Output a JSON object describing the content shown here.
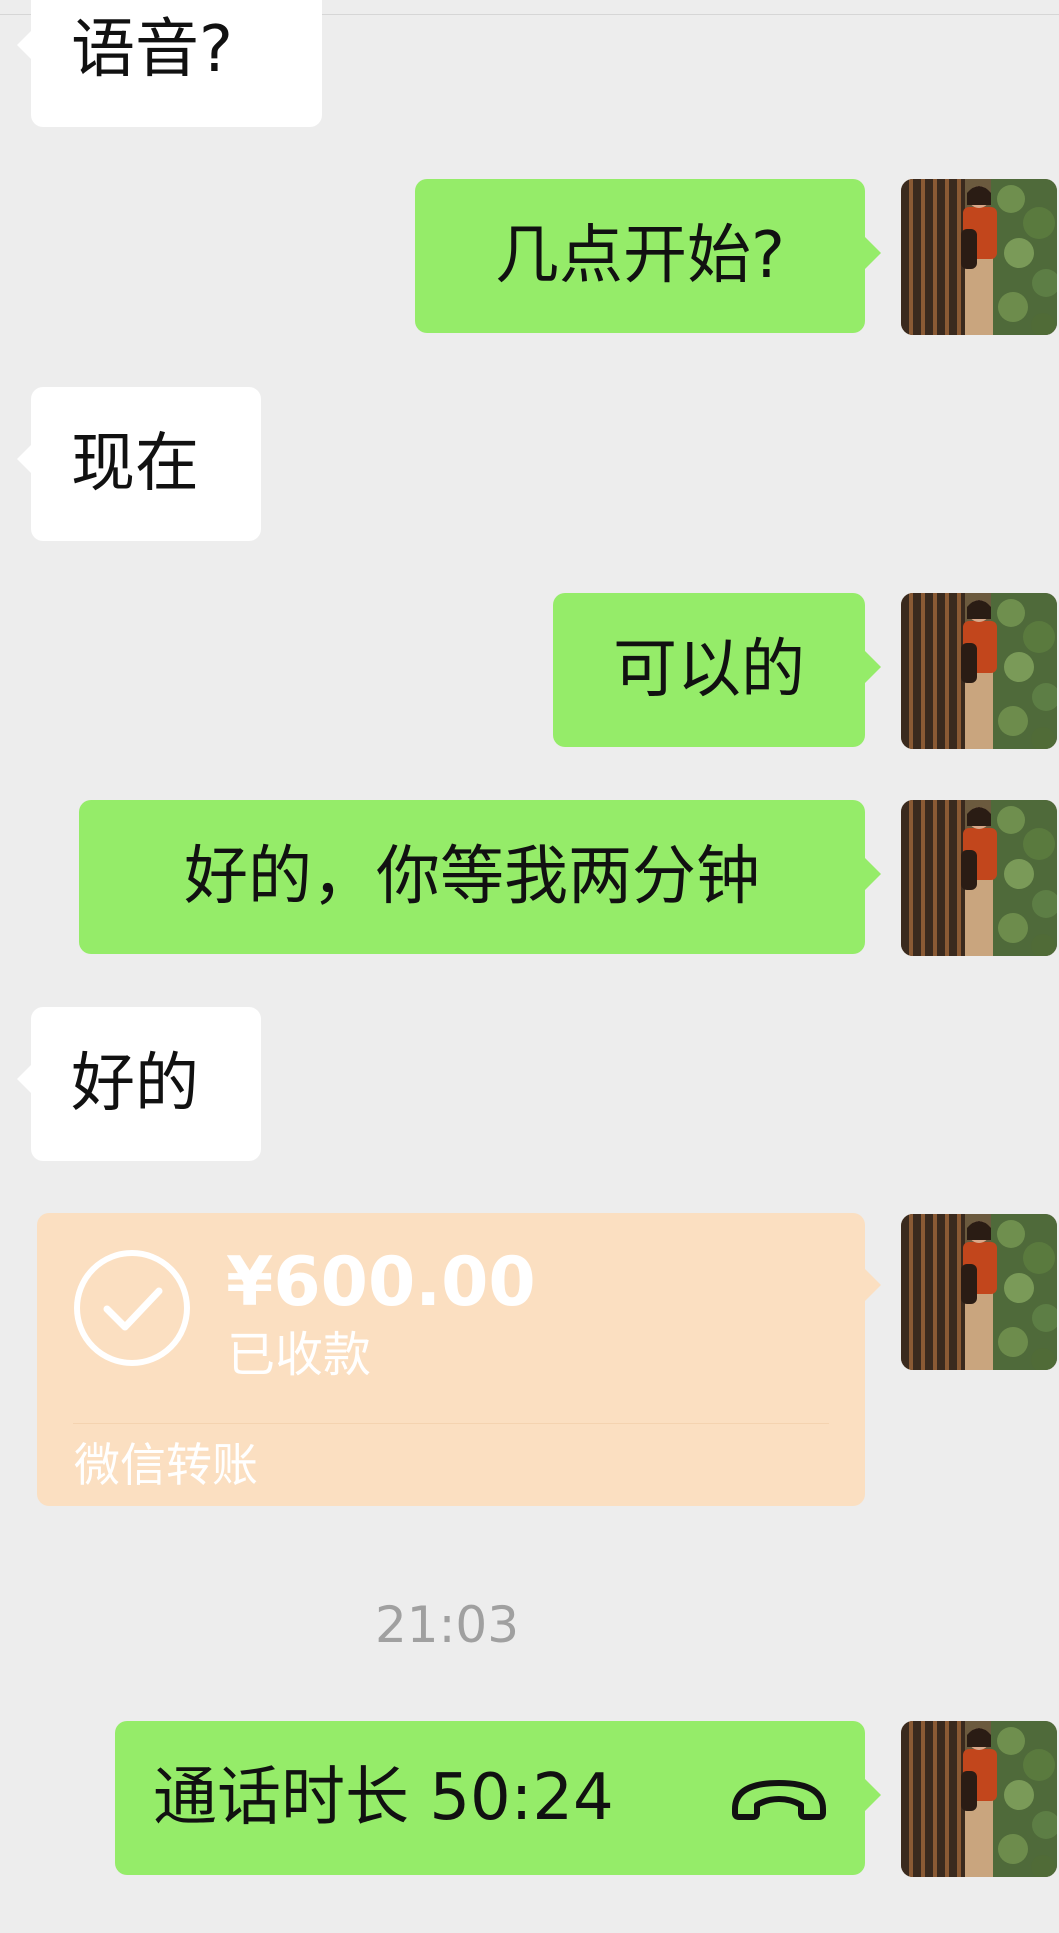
{
  "messages": [
    {
      "id": "m1",
      "direction": "incoming",
      "text": "语音?"
    },
    {
      "id": "m2",
      "direction": "outgoing",
      "text": "几点开始?"
    },
    {
      "id": "m3",
      "direction": "incoming",
      "text": "现在"
    },
    {
      "id": "m4",
      "direction": "outgoing",
      "text": "可以的"
    },
    {
      "id": "m5",
      "direction": "outgoing",
      "text": "好的，你等我两分钟"
    },
    {
      "id": "m6",
      "direction": "incoming",
      "text": "好的"
    }
  ],
  "transfer": {
    "amount": "¥600.00",
    "status": "已收款",
    "footer": "微信转账",
    "icon": "check-circle-icon"
  },
  "timestamp": "21:03",
  "call": {
    "text": "通话时长 50:24",
    "icon": "phone-hangup-icon"
  },
  "colors": {
    "background": "#ededed",
    "incoming_bubble": "#ffffff",
    "outgoing_bubble": "#95ec69",
    "transfer_card": "#fbdfc1",
    "timestamp": "#a0a0a0"
  }
}
